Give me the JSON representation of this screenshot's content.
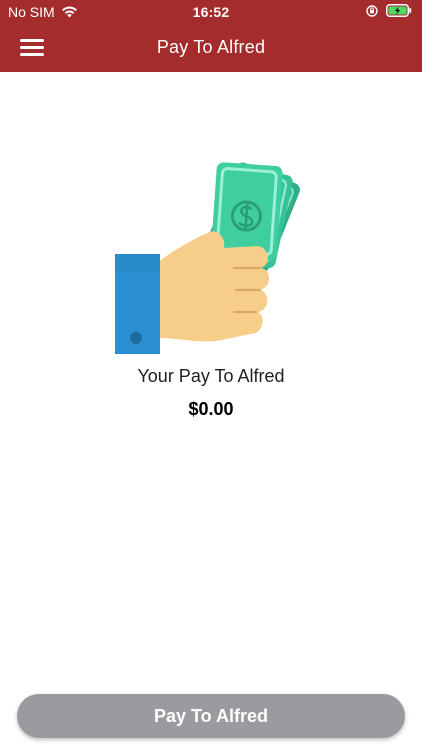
{
  "status_bar": {
    "carrier": "No SIM",
    "time": "16:52"
  },
  "header": {
    "title": "Pay To Alfred",
    "menu_icon": "hamburger-menu-icon",
    "background_color": "#a52c2c"
  },
  "main": {
    "illustration_icon": "hand-holding-money-icon",
    "caption": "Your Pay To Alfred",
    "amount": "$0.00"
  },
  "footer": {
    "pay_button_label": "Pay To Alfred",
    "pay_button_color": "#9b9a9f"
  }
}
